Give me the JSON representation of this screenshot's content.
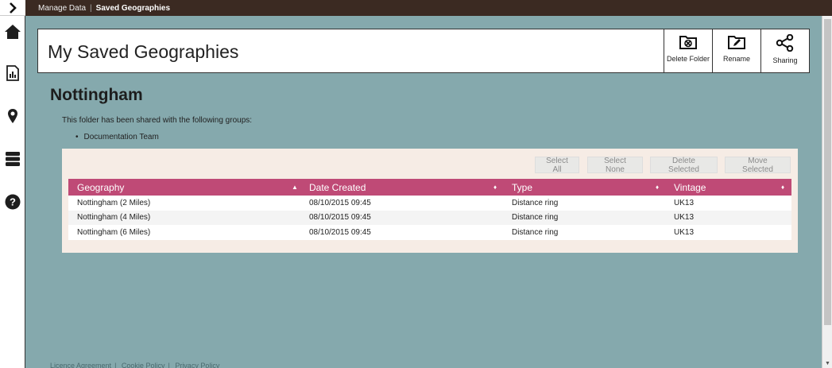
{
  "breadcrumb": {
    "parent": "Manage Data",
    "separator": "|",
    "current": "Saved Geographies"
  },
  "header": {
    "title": "My Saved Geographies",
    "buttons": {
      "delete_folder": "Delete Folder",
      "rename": "Rename",
      "sharing": "Sharing"
    }
  },
  "folder": {
    "name": "Nottingham",
    "shared_text": "This folder has been shared with the following groups:",
    "groups": [
      "Documentation Team"
    ]
  },
  "toolbar": {
    "select_all": "Select All",
    "select_none": "Select None",
    "delete_selected": "Delete Selected",
    "move_selected": "Move Selected"
  },
  "table": {
    "headers": {
      "geography": "Geography",
      "date_created": "Date Created",
      "type": "Type",
      "vintage": "Vintage"
    },
    "sort_icons": {
      "geography": "▲",
      "date_created": "♦",
      "type": "♦",
      "vintage": "♦"
    },
    "rows": [
      {
        "geography": "Nottingham (2 Miles)",
        "date_created": "08/10/2015 09:45",
        "type": "Distance ring",
        "vintage": "UK13"
      },
      {
        "geography": "Nottingham (4 Miles)",
        "date_created": "08/10/2015 09:45",
        "type": "Distance ring",
        "vintage": "UK13"
      },
      {
        "geography": "Nottingham (6 Miles)",
        "date_created": "08/10/2015 09:45",
        "type": "Distance ring",
        "vintage": "UK13"
      }
    ]
  },
  "footer": {
    "license": "Licence Agreement",
    "separator": "|",
    "cookie": "Cookie Policy",
    "privacy": "Privacy Policy"
  },
  "colors": {
    "background": "#85a9ad",
    "topbar": "#3b2a22",
    "table_header": "#bf4a76",
    "table_panel": "#f6ece5"
  },
  "icons": {
    "rail": [
      "chevron-right-icon",
      "home-icon",
      "report-icon",
      "location-pin-icon",
      "database-icon",
      "help-icon"
    ],
    "header": [
      "delete-folder-icon",
      "rename-icon",
      "share-icon"
    ]
  }
}
